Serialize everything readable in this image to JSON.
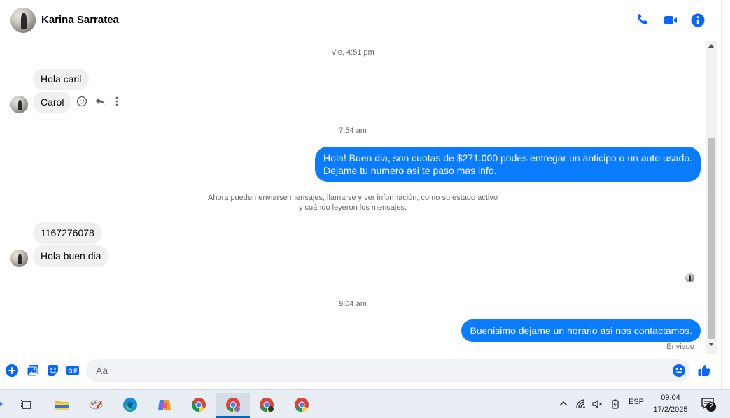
{
  "header": {
    "contact_name": "Karina Sarratea",
    "icons": [
      "phone-icon",
      "video-icon",
      "info-icon"
    ],
    "accent_color": "#0866ff"
  },
  "messages": {
    "ts1": "Vie, 4:51 pm",
    "in1": "Hola caril",
    "in2": "Carol",
    "ts2": "7:54 am",
    "out1_line1": "Hola! Buen dia, son cuotas de $271.000 podes entregar un anticipo o un auto usado.",
    "out1_line2": "Dejame tu numero asi te paso mas info.",
    "sys_line1": "Ahora pueden enviarse mensajes, llamarse y ver información, como su estado activo",
    "sys_line2": "y cuándo leyeron los mensajes.",
    "in3": "1167276078",
    "in4": "Hola buen dia",
    "ts3": "9:04 am",
    "out2": "Buenisimo dejame un horario asi nos contactamos.",
    "status": "Enviado",
    "bubble_out_color": "#0a7cff",
    "bubble_in_color": "#f0f0f0"
  },
  "composer": {
    "placeholder": "Aa",
    "value": "",
    "gif_label": "GIF",
    "icons": [
      "plus-icon",
      "photo-icon",
      "sticker-icon",
      "gif-icon",
      "emoji-icon",
      "like-icon"
    ]
  },
  "taskbar": {
    "apps": [
      "task-view-icon",
      "file-explorer-icon",
      "paint-icon",
      "edge-icon",
      "copilot-icon",
      "chrome-icon",
      "chrome-profile-icon",
      "chrome-profile-icon",
      "chrome-icon"
    ],
    "language": "ESP",
    "time": "09:04",
    "date": "17/2/2025",
    "notification_count": "2"
  }
}
